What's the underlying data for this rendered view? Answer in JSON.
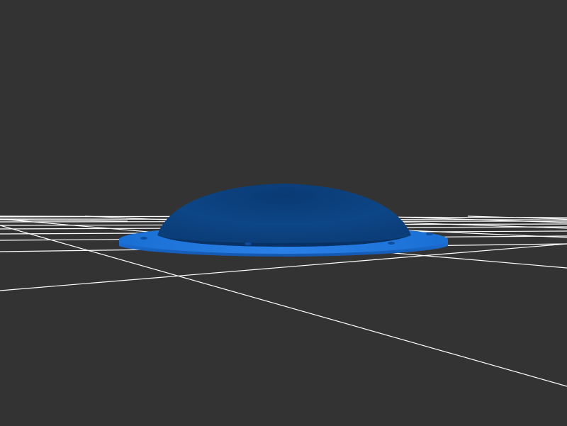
{
  "scene": {
    "background_color": "#333333",
    "grid_color": "#ffffff",
    "model": {
      "name": "dome-with-flange",
      "dome_color": "#0f4f9a",
      "dome_shadow_color": "#062a5a",
      "flange_top_color": "#1a6fd4",
      "flange_side_color": "#1563c2",
      "mounting_holes": 4
    }
  }
}
